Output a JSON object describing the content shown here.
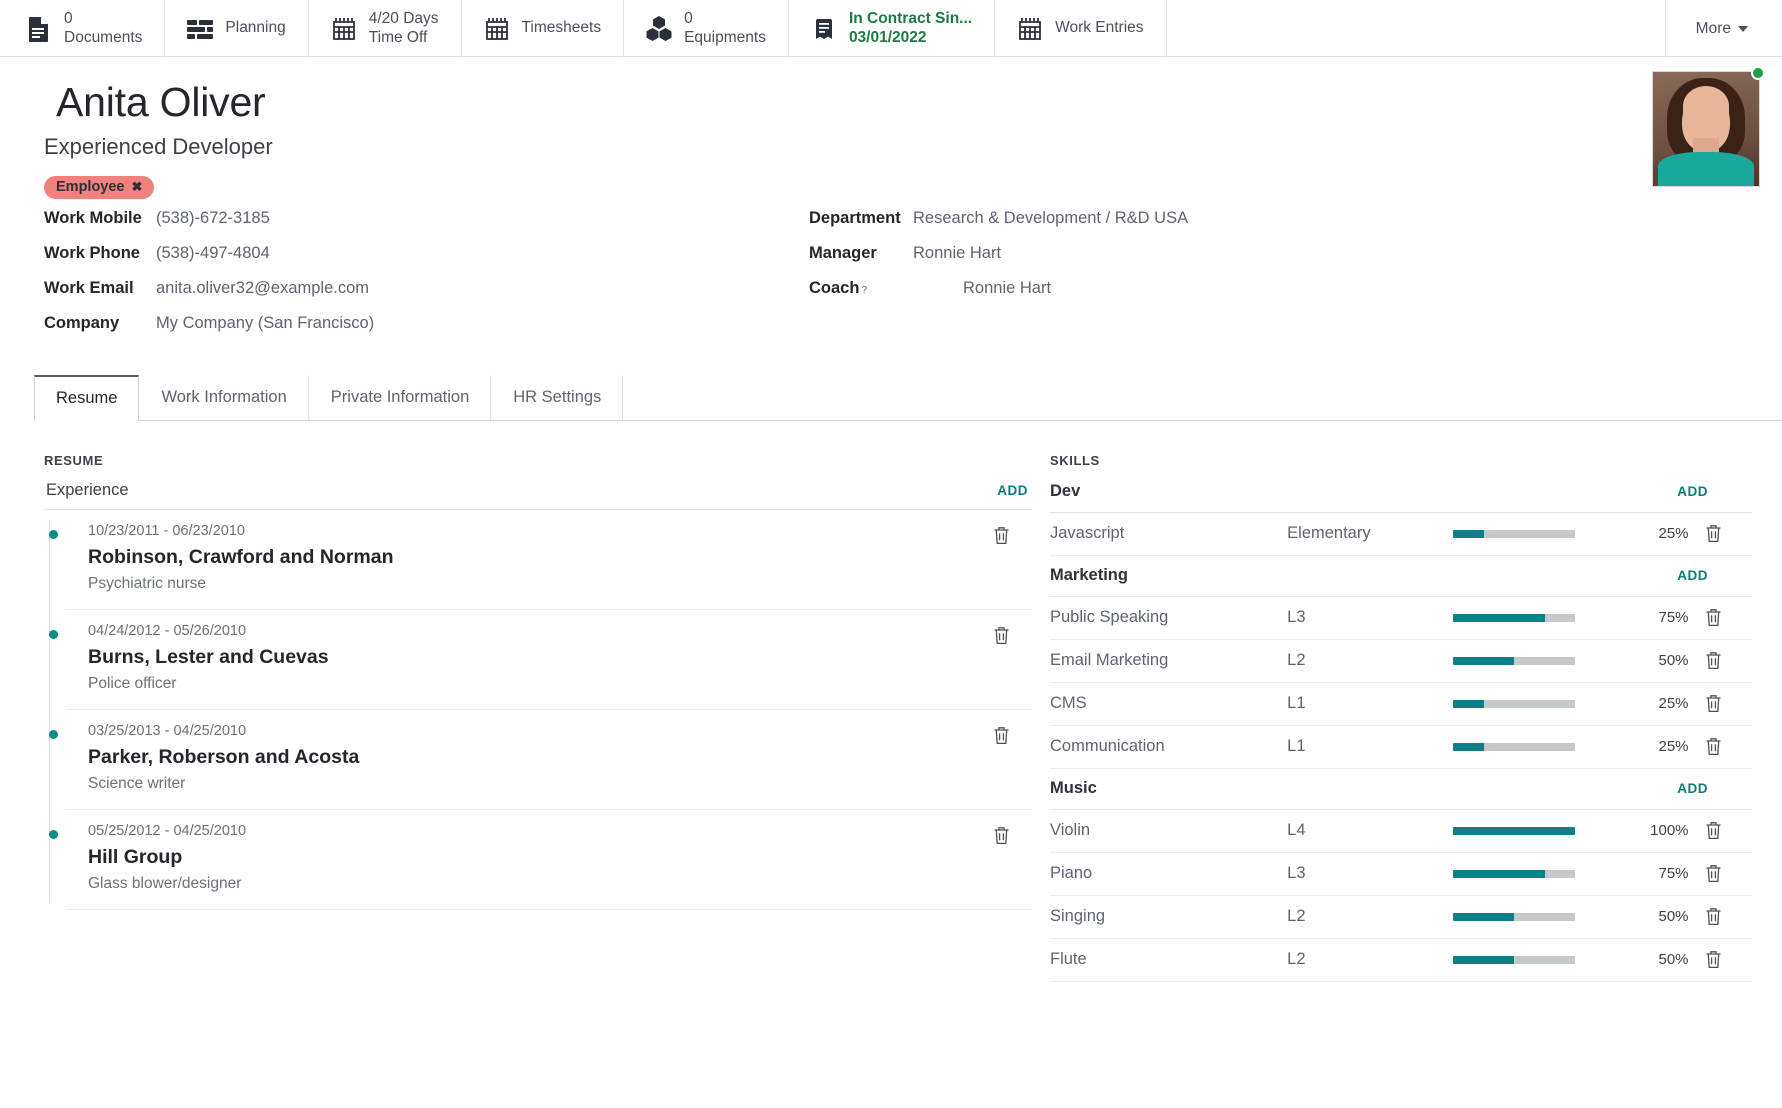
{
  "statbar": {
    "buttons": [
      {
        "icon": "document-icon",
        "value": "0",
        "label": "Documents",
        "single": false
      },
      {
        "icon": "planning-icon",
        "value": "",
        "label": "Planning",
        "single": true
      },
      {
        "icon": "calendar-icon",
        "value": "4/20 Days",
        "label": "Time Off",
        "single": false
      },
      {
        "icon": "calendar-icon",
        "value": "",
        "label": "Timesheets",
        "single": true
      },
      {
        "icon": "boxes-icon",
        "value": "0",
        "label": "Equipments",
        "single": false
      },
      {
        "icon": "contract-book-icon",
        "value": "In Contract Sin...",
        "label": "03/01/2022",
        "single": false,
        "green": true
      },
      {
        "icon": "calendar-icon",
        "value": "",
        "label": "Work Entries",
        "single": true
      }
    ],
    "more_label": "More"
  },
  "header": {
    "name": "Anita Oliver",
    "job_title": "Experienced Developer",
    "tag": "Employee",
    "tag_remove": "✖",
    "left_fields": [
      {
        "label": "Work Mobile",
        "value": "(538)-672-3185"
      },
      {
        "label": "Work Phone",
        "value": "(538)-497-4804"
      },
      {
        "label": "Work Email",
        "value": "anita.oliver32@example.com"
      },
      {
        "label": "Company",
        "value": "My Company (San Francisco)"
      }
    ],
    "right_fields": [
      {
        "label": "Department",
        "value": "Research & Development / R&D USA",
        "sup": ""
      },
      {
        "label": "Manager",
        "value": "Ronnie Hart",
        "sup": ""
      },
      {
        "label": "Coach",
        "value": "Ronnie Hart",
        "sup": "?"
      }
    ]
  },
  "tabs": [
    {
      "label": "Resume",
      "active": true
    },
    {
      "label": "Work Information",
      "active": false
    },
    {
      "label": "Private Information",
      "active": false
    },
    {
      "label": "HR Settings",
      "active": false
    }
  ],
  "resume": {
    "section_title": "RESUME",
    "group_title": "Experience",
    "add_label": "ADD",
    "items": [
      {
        "date": "10/23/2011 - 06/23/2010",
        "org": "Robinson, Crawford and Norman",
        "role": "Psychiatric nurse"
      },
      {
        "date": "04/24/2012 - 05/26/2010",
        "org": "Burns, Lester and Cuevas",
        "role": "Police officer"
      },
      {
        "date": "03/25/2013 - 04/25/2010",
        "org": "Parker, Roberson and Acosta",
        "role": "Science writer"
      },
      {
        "date": "05/25/2012 - 04/25/2010",
        "org": "Hill Group",
        "role": "Glass blower/designer"
      }
    ]
  },
  "skills": {
    "section_title": "SKILLS",
    "add_label": "ADD",
    "groups": [
      {
        "name": "Dev",
        "rows": [
          {
            "name": "Javascript",
            "level": "Elementary",
            "percent": "25%",
            "value": 25
          }
        ]
      },
      {
        "name": "Marketing",
        "rows": [
          {
            "name": "Public Speaking",
            "level": "L3",
            "percent": "75%",
            "value": 75
          },
          {
            "name": "Email Marketing",
            "level": "L2",
            "percent": "50%",
            "value": 50
          },
          {
            "name": "CMS",
            "level": "L1",
            "percent": "25%",
            "value": 25
          },
          {
            "name": "Communication",
            "level": "L1",
            "percent": "25%",
            "value": 25
          }
        ]
      },
      {
        "name": "Music",
        "rows": [
          {
            "name": "Violin",
            "level": "L4",
            "percent": "100%",
            "value": 100
          },
          {
            "name": "Piano",
            "level": "L3",
            "percent": "75%",
            "value": 75
          },
          {
            "name": "Singing",
            "level": "L2",
            "percent": "50%",
            "value": 50
          },
          {
            "name": "Flute",
            "level": "L2",
            "percent": "50%",
            "value": 50
          }
        ]
      }
    ]
  },
  "colors": {
    "accent_teal": "#0d8087",
    "tag_red": "#f2807c",
    "contract_green": "#1f7a3f",
    "online_green": "#19a340"
  }
}
